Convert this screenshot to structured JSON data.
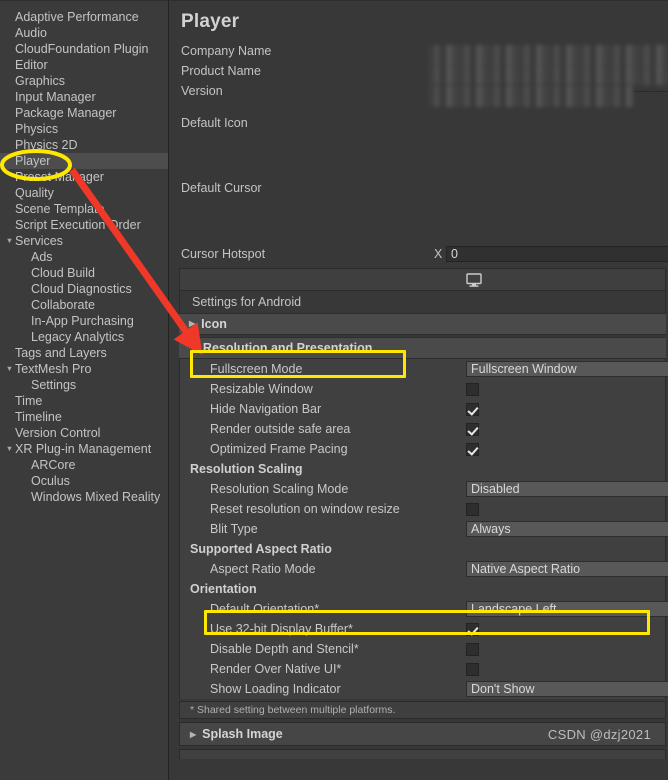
{
  "window": {
    "panel_title": "Player",
    "accent_highlight": "#ffe800",
    "arrow_color": "#f03828",
    "background": "#383838"
  },
  "sidebar": {
    "items": [
      {
        "label": "Adaptive Performance",
        "indent": 1,
        "caret": "",
        "selected": false
      },
      {
        "label": "Audio",
        "indent": 1,
        "caret": "",
        "selected": false
      },
      {
        "label": "CloudFoundation Plugin",
        "indent": 1,
        "caret": "",
        "selected": false
      },
      {
        "label": "Editor",
        "indent": 1,
        "caret": "",
        "selected": false
      },
      {
        "label": "Graphics",
        "indent": 1,
        "caret": "",
        "selected": false
      },
      {
        "label": "Input Manager",
        "indent": 1,
        "caret": "",
        "selected": false
      },
      {
        "label": "Package Manager",
        "indent": 1,
        "caret": "",
        "selected": false
      },
      {
        "label": "Physics",
        "indent": 1,
        "caret": "",
        "selected": false
      },
      {
        "label": "Physics 2D",
        "indent": 1,
        "caret": "",
        "selected": false
      },
      {
        "label": "Player",
        "indent": 1,
        "caret": "",
        "selected": true
      },
      {
        "label": "Preset Manager",
        "indent": 1,
        "caret": "",
        "selected": false
      },
      {
        "label": "Quality",
        "indent": 1,
        "caret": "",
        "selected": false
      },
      {
        "label": "Scene Template",
        "indent": 1,
        "caret": "",
        "selected": false
      },
      {
        "label": "Script Execution Order",
        "indent": 1,
        "caret": "",
        "selected": false
      },
      {
        "label": "Services",
        "indent": 0,
        "caret": "▼",
        "selected": false
      },
      {
        "label": "Ads",
        "indent": 2,
        "caret": "",
        "selected": false
      },
      {
        "label": "Cloud Build",
        "indent": 2,
        "caret": "",
        "selected": false
      },
      {
        "label": "Cloud Diagnostics",
        "indent": 2,
        "caret": "",
        "selected": false
      },
      {
        "label": "Collaborate",
        "indent": 2,
        "caret": "",
        "selected": false
      },
      {
        "label": "In-App Purchasing",
        "indent": 2,
        "caret": "",
        "selected": false
      },
      {
        "label": "Legacy Analytics",
        "indent": 2,
        "caret": "",
        "selected": false
      },
      {
        "label": "Tags and Layers",
        "indent": 1,
        "caret": "",
        "selected": false
      },
      {
        "label": "TextMesh Pro",
        "indent": 0,
        "caret": "▼",
        "selected": false
      },
      {
        "label": "Settings",
        "indent": 2,
        "caret": "",
        "selected": false
      },
      {
        "label": "Time",
        "indent": 1,
        "caret": "",
        "selected": false
      },
      {
        "label": "Timeline",
        "indent": 1,
        "caret": "",
        "selected": false
      },
      {
        "label": "Version Control",
        "indent": 1,
        "caret": "",
        "selected": false
      },
      {
        "label": "XR Plug-in Management",
        "indent": 0,
        "caret": "▼",
        "selected": false
      },
      {
        "label": "ARCore",
        "indent": 2,
        "caret": "",
        "selected": false
      },
      {
        "label": "Oculus",
        "indent": 2,
        "caret": "",
        "selected": false
      },
      {
        "label": "Windows Mixed Reality",
        "indent": 2,
        "caret": "",
        "selected": false
      }
    ]
  },
  "main": {
    "title": "Player",
    "identification": [
      {
        "label": "Company Name",
        "value": "",
        "redacted": true
      },
      {
        "label": "Product Name",
        "value": "",
        "redacted": true
      },
      {
        "label": "Version",
        "value": "",
        "redacted": true
      }
    ],
    "default_icon_label": "Default Icon",
    "default_cursor_label": "Default Cursor",
    "cursor_hotspot": {
      "label": "Cursor Hotspot",
      "axis_label": "X",
      "value": "0"
    },
    "platform_tab_icon": "monitor-icon",
    "settings_for_label": "Settings for Android",
    "sections": [
      {
        "label": "Icon",
        "expanded": false,
        "caret": "▶"
      },
      {
        "label": "Resolution and Presentation",
        "expanded": true,
        "caret": "▼",
        "highlighted": true
      }
    ],
    "resolution_rows": [
      {
        "label": "Fullscreen Mode",
        "type": "dropdown",
        "value": "Fullscreen Window",
        "kind": "field"
      },
      {
        "label": "Resizable Window",
        "type": "checkbox",
        "checked": false,
        "kind": "field"
      },
      {
        "label": "Hide Navigation Bar",
        "type": "checkbox",
        "checked": true,
        "kind": "field"
      },
      {
        "label": "Render outside safe area",
        "type": "checkbox",
        "checked": true,
        "kind": "field"
      },
      {
        "label": "Optimized Frame Pacing",
        "type": "checkbox",
        "checked": true,
        "kind": "field"
      },
      {
        "label": "Resolution Scaling",
        "type": "none",
        "kind": "group"
      },
      {
        "label": "Resolution Scaling Mode",
        "type": "dropdown",
        "value": "Disabled",
        "kind": "field"
      },
      {
        "label": "Reset resolution on window resize",
        "type": "checkbox",
        "checked": false,
        "kind": "field"
      },
      {
        "label": "Blit Type",
        "type": "dropdown",
        "value": "Always",
        "kind": "field"
      },
      {
        "label": "Supported Aspect Ratio",
        "type": "none",
        "kind": "group"
      },
      {
        "label": "Aspect Ratio Mode",
        "type": "dropdown",
        "value": "Native Aspect Ratio",
        "kind": "field"
      },
      {
        "label": "Orientation",
        "type": "none",
        "kind": "group"
      },
      {
        "label": "Default Orientation*",
        "type": "dropdown",
        "value": "Landscape Left",
        "kind": "field",
        "highlighted": true
      },
      {
        "label": "Use 32-bit Display Buffer*",
        "type": "checkbox",
        "checked": true,
        "kind": "field"
      },
      {
        "label": "Disable Depth and Stencil*",
        "type": "checkbox",
        "checked": false,
        "kind": "field"
      },
      {
        "label": "Render Over Native UI*",
        "type": "checkbox",
        "checked": false,
        "kind": "field"
      },
      {
        "label": "Show Loading Indicator",
        "type": "dropdown",
        "value": "Don't Show",
        "kind": "field"
      }
    ],
    "footnote": "* Shared setting between multiple platforms.",
    "splash_image_label": "Splash Image",
    "splash_image_caret": "▶",
    "watermark": "CSDN @dzj2021"
  }
}
